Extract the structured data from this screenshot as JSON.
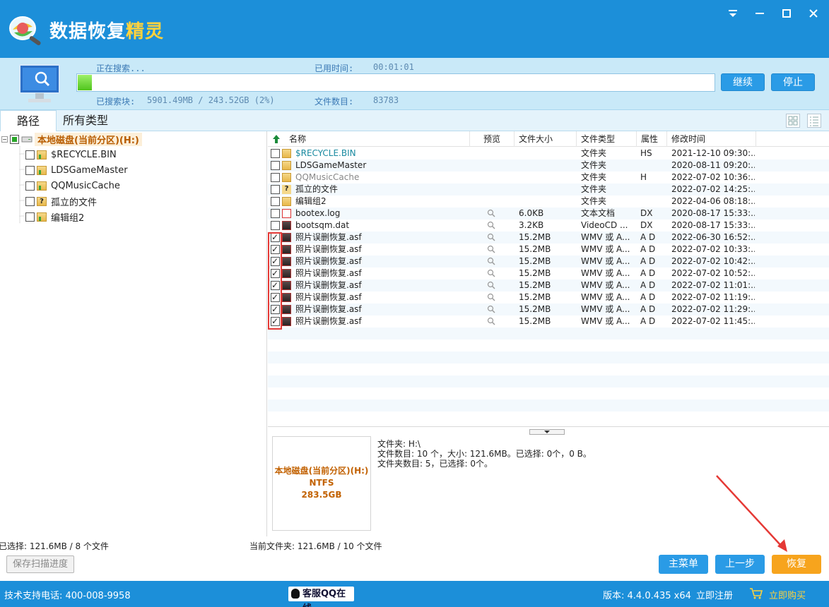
{
  "app": {
    "title_main": "数据恢复",
    "title_accent": "精灵",
    "window_controls": [
      "menu",
      "minimize",
      "maximize",
      "close"
    ]
  },
  "scan": {
    "status_label": "正在搜索...",
    "elapsed_label": "已用时间:",
    "elapsed_value": "00:01:01",
    "searched_label": "已搜索块:",
    "searched_value": "5901.49MB / 243.52GB (2%)",
    "count_label": "文件数目:",
    "count_value": "83783",
    "progress": 0.02,
    "continue_label": "继续",
    "stop_label": "停止"
  },
  "tabs": [
    "路径",
    "所有类型"
  ],
  "tree": {
    "root": "本地磁盘(当前分区)(H:)",
    "items": [
      "$RECYCLE.BIN",
      "LDSGameMaster",
      "QQMusicCache",
      "孤立的文件",
      "编辑组2"
    ]
  },
  "filelist": {
    "columns": [
      "名称",
      "预览",
      "文件大小",
      "文件类型",
      "属性",
      "修改时间"
    ],
    "rows": [
      {
        "name": "$RECYCLE.BIN",
        "size": "",
        "type": "文件夹",
        "attr": "HS",
        "mtime": "2021-12-10 09:30:...",
        "checked": false,
        "kind": "folder",
        "color": "#1a8aa0"
      },
      {
        "name": "LDSGameMaster",
        "size": "",
        "type": "文件夹",
        "attr": "",
        "mtime": "2020-08-11 09:20:...",
        "checked": false,
        "kind": "folder",
        "color": "#222"
      },
      {
        "name": "QQMusicCache",
        "size": "",
        "type": "文件夹",
        "attr": "H",
        "mtime": "2022-07-02 10:36:...",
        "checked": false,
        "kind": "folder",
        "color": "#888"
      },
      {
        "name": "孤立的文件",
        "size": "",
        "type": "文件夹",
        "attr": "",
        "mtime": "2022-07-02 14:25:...",
        "checked": false,
        "kind": "unknown",
        "color": "#222"
      },
      {
        "name": "编辑组2",
        "size": "",
        "type": "文件夹",
        "attr": "",
        "mtime": "2022-04-06 08:18:...",
        "checked": false,
        "kind": "folder",
        "color": "#222"
      },
      {
        "name": "bootex.log",
        "size": "6.0KB",
        "type": "文本文档",
        "attr": "DX",
        "mtime": "2020-08-17 15:33:...",
        "checked": false,
        "kind": "deleted",
        "color": "#222"
      },
      {
        "name": "bootsqm.dat",
        "size": "3.2KB",
        "type": "VideoCD ...",
        "attr": "DX",
        "mtime": "2020-08-17 15:33:...",
        "checked": false,
        "kind": "media",
        "color": "#222"
      },
      {
        "name": "照片误删恢复.asf",
        "size": "15.2MB",
        "type": "WMV 或 A...",
        "attr": "A D",
        "mtime": "2022-06-30 16:52:...",
        "checked": true,
        "kind": "media",
        "color": "#222"
      },
      {
        "name": "照片误删恢复.asf",
        "size": "15.2MB",
        "type": "WMV 或 A...",
        "attr": "A D",
        "mtime": "2022-07-02 10:33:...",
        "checked": true,
        "kind": "media",
        "color": "#222"
      },
      {
        "name": "照片误删恢复.asf",
        "size": "15.2MB",
        "type": "WMV 或 A...",
        "attr": "A D",
        "mtime": "2022-07-02 10:42:...",
        "checked": true,
        "kind": "media",
        "color": "#222"
      },
      {
        "name": "照片误删恢复.asf",
        "size": "15.2MB",
        "type": "WMV 或 A...",
        "attr": "A D",
        "mtime": "2022-07-02 10:52:...",
        "checked": true,
        "kind": "media",
        "color": "#222"
      },
      {
        "name": "照片误删恢复.asf",
        "size": "15.2MB",
        "type": "WMV 或 A...",
        "attr": "A D",
        "mtime": "2022-07-02 11:01:...",
        "checked": true,
        "kind": "media",
        "color": "#222"
      },
      {
        "name": "照片误删恢复.asf",
        "size": "15.2MB",
        "type": "WMV 或 A...",
        "attr": "A D",
        "mtime": "2022-07-02 11:19:...",
        "checked": true,
        "kind": "media",
        "color": "#222"
      },
      {
        "name": "照片误删恢复.asf",
        "size": "15.2MB",
        "type": "WMV 或 A...",
        "attr": "A D",
        "mtime": "2022-07-02 11:29:...",
        "checked": true,
        "kind": "media",
        "color": "#222"
      },
      {
        "name": "照片误删恢复.asf",
        "size": "15.2MB",
        "type": "WMV 或 A...",
        "attr": "A D",
        "mtime": "2022-07-02 11:45:...",
        "checked": true,
        "kind": "media",
        "color": "#222"
      }
    ]
  },
  "details": {
    "drive_name": "本地磁盘(当前分区)(H:)",
    "fs": "NTFS",
    "capacity": "283.5GB",
    "line1": "文件夹: H:\\",
    "line2": "文件数目: 10 个，大小: 121.6MB。已选择: 0个，0 B。",
    "line3": "文件夹数目: 5，已选择: 0个。"
  },
  "status": {
    "selected": "已选择: 121.6MB / 8 个文件",
    "current_folder": "当前文件夹: 121.6MB / 10 个文件"
  },
  "buttons": {
    "save_progress": "保存扫描进度",
    "main_menu": "主菜单",
    "prev_step": "上一步",
    "recover": "恢复"
  },
  "footer": {
    "support": "技术支持电话: 400-008-9958",
    "qq": "客服QQ在线",
    "version": "版本: 4.4.0.435 x64",
    "register": "立即注册",
    "buy": "立即购买"
  },
  "colors": {
    "brand": "#1c8fd9",
    "accent": "#ffd23c",
    "recover_button": "#f7a41d",
    "nav_button": "#2a9be6"
  }
}
